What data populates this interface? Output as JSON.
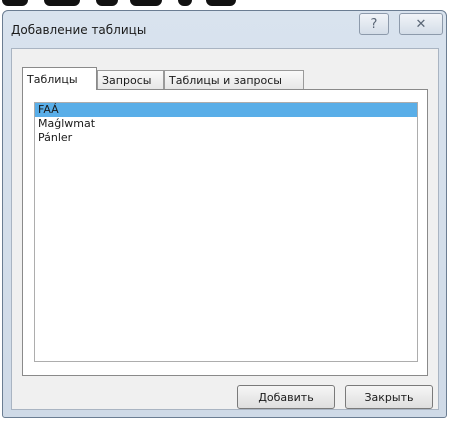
{
  "window": {
    "title": "Добавление таблицы",
    "help_glyph": "?",
    "close_glyph": "✕"
  },
  "tabs": [
    {
      "label": "Таблицы",
      "active": true
    },
    {
      "label": "Запросы",
      "active": false
    },
    {
      "label": "Таблицы и запросы",
      "active": false
    }
  ],
  "list": {
    "items": [
      {
        "label": "FAÁ",
        "selected": true
      },
      {
        "label": "Maǵlwmat",
        "selected": false
      },
      {
        "label": "Pánler",
        "selected": false
      }
    ]
  },
  "buttons": {
    "add_label": "Добавить",
    "close_label": "Закрыть"
  },
  "colors": {
    "selection": "#59aee8",
    "frame": "#d9e3ee"
  }
}
